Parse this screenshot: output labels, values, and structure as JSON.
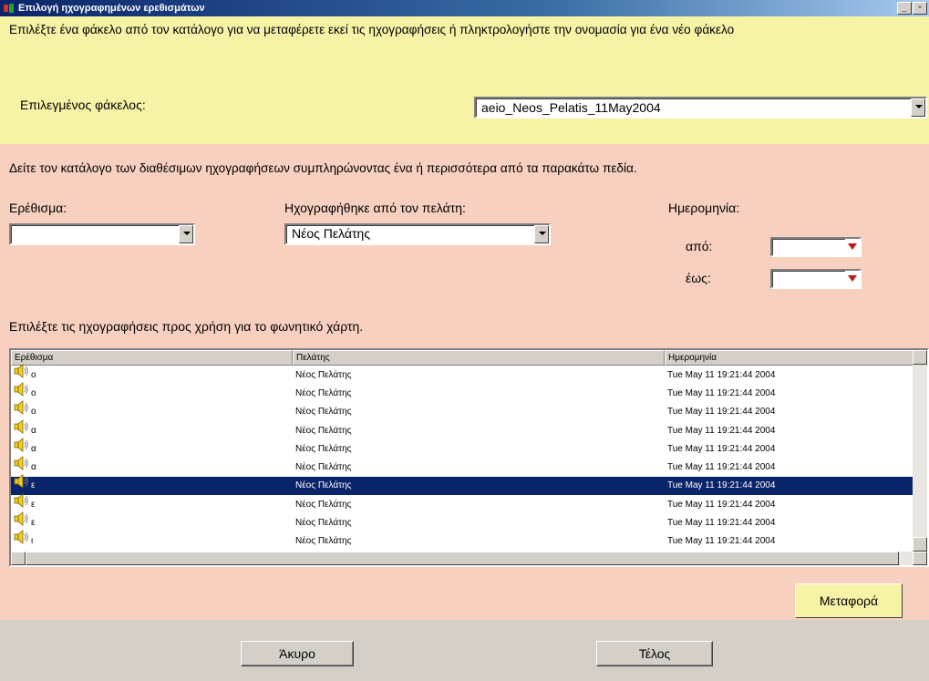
{
  "window": {
    "title": "Επιλογή ηχογραφημένων ερεθισμάτων",
    "minimize_glyph": "_",
    "maximize_glyph": "▫"
  },
  "folder_section": {
    "instruction": "Επιλέξτε ένα φάκελο από τον κατάλογο για να μεταφέρετε εκεί τις ηχογραφήσεις ή πληκτρολογήστε την ονομασία για ένα νέο φάκελο",
    "selected_folder_label": "Επιλεγμένος φάκελος:",
    "selected_folder_value": "aeio_Neos_Pelatis_11May2004"
  },
  "filter_section": {
    "instruction": "Δείτε τον κατάλογο των διαθέσιμων ηχογραφήσεων συμπληρώνοντας ένα ή περισσότερα από τα παρακάτω πεδία.",
    "stimulus_label": "Ερέθισμα:",
    "stimulus_value": "",
    "recorded_by_label": "Ηχογραφήθηκε από τον πελάτη:",
    "recorded_by_value": "Νέος Πελάτης",
    "date_label": "Ημερομηνία:",
    "from_label": "από:",
    "to_label": "έως:"
  },
  "recordings": {
    "instruction": "Επιλέξτε τις ηχογραφήσεις προς χρήση για το φωνητικό χάρτη.",
    "columns": [
      "Ερέθισμα",
      "Πελάτης",
      "Ημερομηνία"
    ],
    "rows": [
      {
        "stimulus": "o",
        "client": "Νέος Πελάτης",
        "date": "Tue May 11 19:21:44 2004",
        "selected": false
      },
      {
        "stimulus": "o",
        "client": "Νέος Πελάτης",
        "date": "Tue May 11 19:21:44 2004",
        "selected": false
      },
      {
        "stimulus": "o",
        "client": "Νέος Πελάτης",
        "date": "Tue May 11 19:21:44 2004",
        "selected": false
      },
      {
        "stimulus": "α",
        "client": "Νέος Πελάτης",
        "date": "Tue May 11 19:21:44 2004",
        "selected": false
      },
      {
        "stimulus": "α",
        "client": "Νέος Πελάτης",
        "date": "Tue May 11 19:21:44 2004",
        "selected": false
      },
      {
        "stimulus": "α",
        "client": "Νέος Πελάτης",
        "date": "Tue May 11 19:21:44 2004",
        "selected": false
      },
      {
        "stimulus": "ε",
        "client": "Νέος Πελάτης",
        "date": "Tue May 11 19:21:44 2004",
        "selected": true
      },
      {
        "stimulus": "ε",
        "client": "Νέος Πελάτης",
        "date": "Tue May 11 19:21:44 2004",
        "selected": false
      },
      {
        "stimulus": "ε",
        "client": "Νέος Πελάτης",
        "date": "Tue May 11 19:21:44 2004",
        "selected": false
      },
      {
        "stimulus": "ι",
        "client": "Νέος Πελάτης",
        "date": "Tue May 11 19:21:44 2004",
        "selected": false
      }
    ]
  },
  "buttons": {
    "transfer": "Μεταφορά",
    "cancel": "Άκυρο",
    "finish": "Τέλος"
  },
  "colors": {
    "top_pane": "#f7f3a6",
    "middle_pane": "#f8d0c0",
    "selection": "#0a246a"
  }
}
